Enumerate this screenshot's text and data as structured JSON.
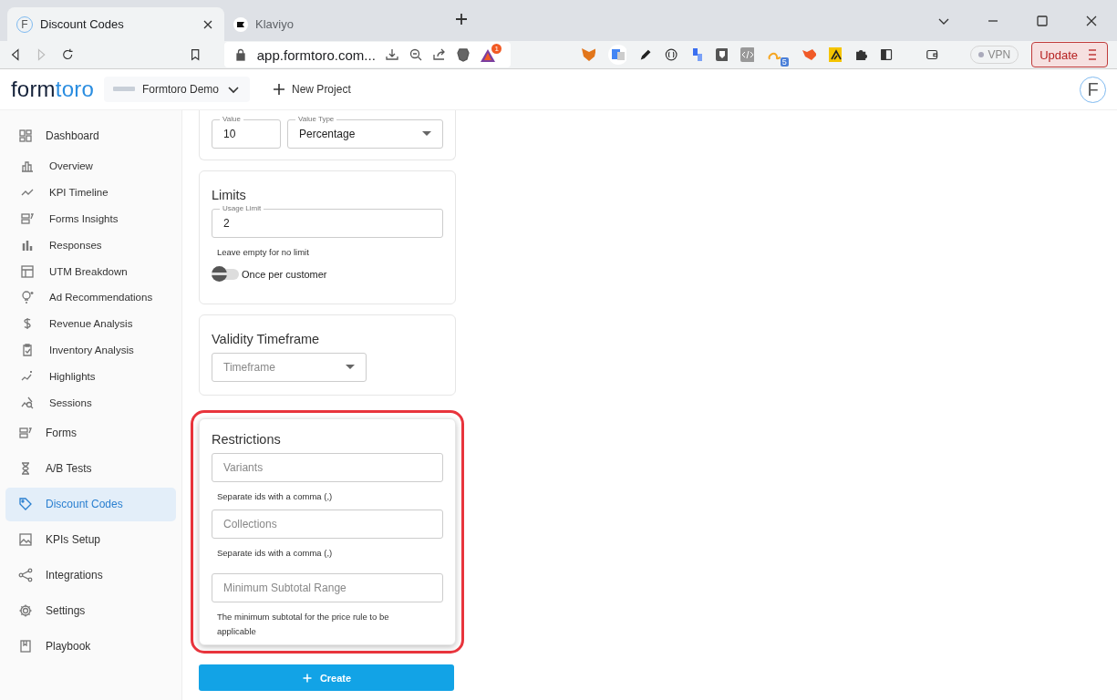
{
  "browser": {
    "tabs": [
      {
        "title": "Discount Codes",
        "favicon": "F",
        "selected": true
      },
      {
        "title": "Klaviyo",
        "selected": false
      }
    ],
    "url": "app.formtoro.com...",
    "rewards_badge": "1",
    "extension_badge": "5",
    "vpn": "VPN",
    "update": "Update"
  },
  "header": {
    "logo": {
      "dark": "form",
      "accent": "toro"
    },
    "project": "Formtoro Demo",
    "new_project": "New Project",
    "avatar": "F"
  },
  "sidebar": {
    "items": [
      {
        "label": "Dashboard",
        "kind": "section",
        "selected": false
      },
      {
        "label": "Overview",
        "kind": "sub",
        "selected": false
      },
      {
        "label": "KPI Timeline",
        "kind": "sub",
        "selected": false
      },
      {
        "label": "Forms Insights",
        "kind": "sub",
        "selected": false
      },
      {
        "label": "Responses",
        "kind": "sub",
        "selected": false
      },
      {
        "label": "UTM Breakdown",
        "kind": "sub",
        "selected": false
      },
      {
        "label": "Ad Recommendations",
        "kind": "sub",
        "selected": false
      },
      {
        "label": "Revenue Analysis",
        "kind": "sub",
        "selected": false
      },
      {
        "label": "Inventory Analysis",
        "kind": "sub",
        "selected": false
      },
      {
        "label": "Highlights",
        "kind": "sub",
        "selected": false
      },
      {
        "label": "Sessions",
        "kind": "sub",
        "selected": false
      },
      {
        "label": "Forms",
        "kind": "section",
        "selected": false
      },
      {
        "label": "A/B Tests",
        "kind": "section",
        "selected": false
      },
      {
        "label": "Discount Codes",
        "kind": "section",
        "selected": true
      },
      {
        "label": "KPIs Setup",
        "kind": "section",
        "selected": false
      },
      {
        "label": "Integrations",
        "kind": "section",
        "selected": false
      },
      {
        "label": "Settings",
        "kind": "section",
        "selected": false
      },
      {
        "label": "Playbook",
        "kind": "section",
        "selected": false
      }
    ]
  },
  "value_card": {
    "value": {
      "label": "Value",
      "value": "10"
    },
    "value_type": {
      "label": "Value Type",
      "value": "Percentage"
    }
  },
  "limits_card": {
    "title": "Limits",
    "usage_limit": {
      "label": "Usage Limit",
      "value": "2"
    },
    "helper": "Leave empty for no limit",
    "once_per_customer": {
      "label": "Once per customer",
      "on": false
    }
  },
  "validity_card": {
    "title": "Validity Timeframe",
    "timeframe": {
      "placeholder": "Timeframe"
    }
  },
  "restrictions_card": {
    "title": "Restrictions",
    "highlighted": true,
    "fields": [
      {
        "placeholder": "Variants",
        "helper": "Separate ids with a comma (,)"
      },
      {
        "placeholder": "Collections",
        "helper": "Separate ids with a comma (,)"
      },
      {
        "placeholder": "Minimum Subtotal Range",
        "helper": "The minimum subtotal for the price rule to be applicable"
      }
    ]
  },
  "create_button": {
    "label": "Create"
  }
}
